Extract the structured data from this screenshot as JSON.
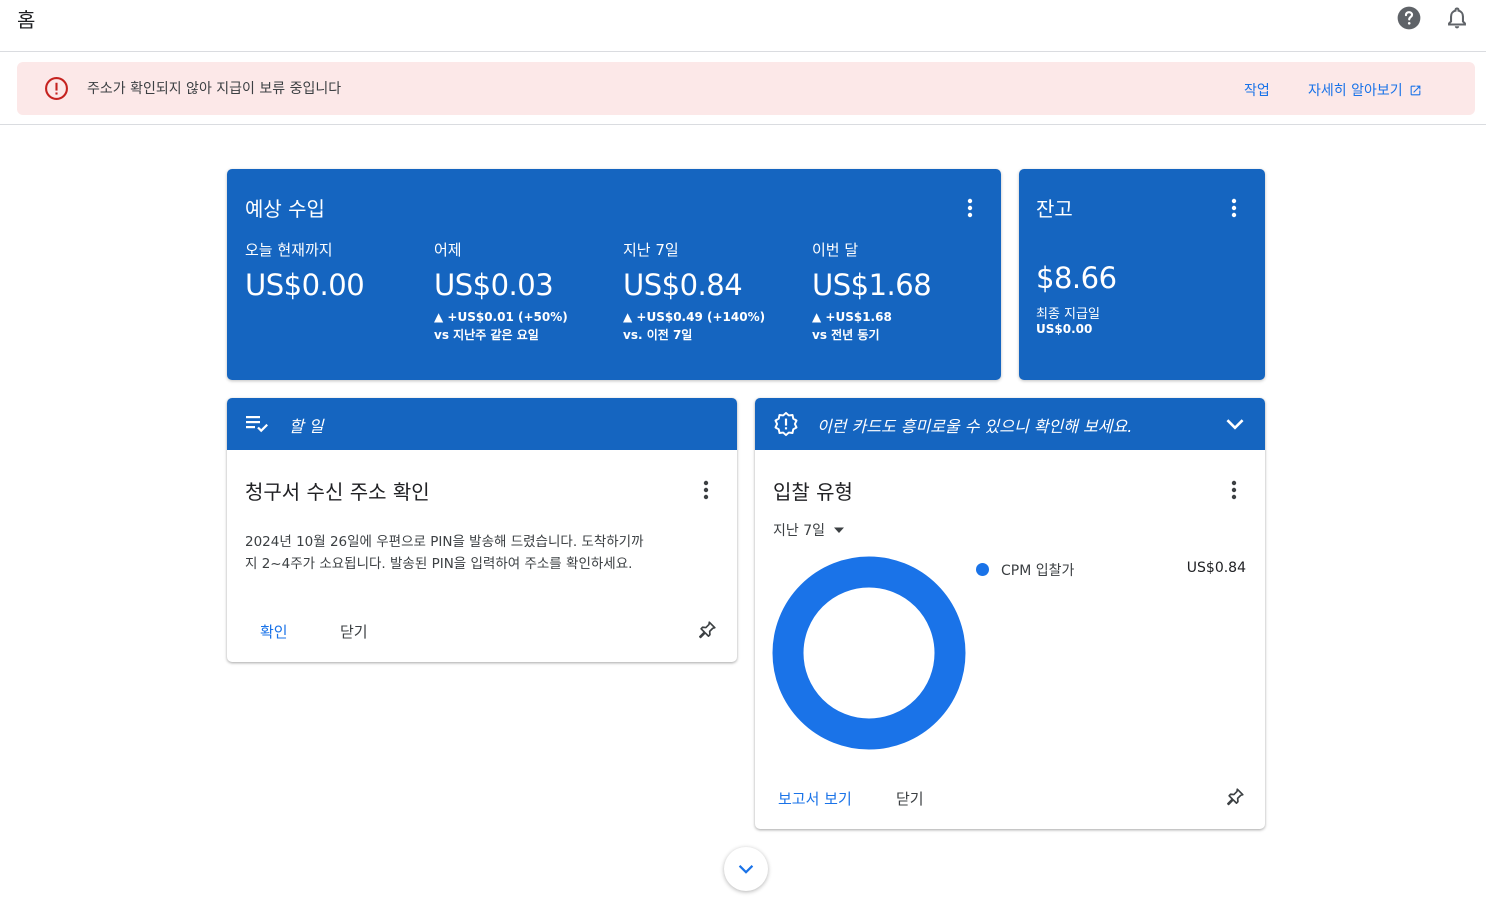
{
  "header": {
    "title": "홈"
  },
  "alert": {
    "message": "주소가 확인되지 않아 지급이 보류 중입니다",
    "action_label": "작업",
    "learn_more_label": "자세히 알아보기"
  },
  "earnings_card": {
    "title": "예상 수입",
    "metrics": [
      {
        "label": "오늘 현재까지",
        "value": "US$0.00",
        "delta": "",
        "compare": ""
      },
      {
        "label": "어제",
        "value": "US$0.03",
        "delta": "▲ +US$0.01 (+50%)",
        "compare": "vs 지난주 같은 요일"
      },
      {
        "label": "지난 7일",
        "value": "US$0.84",
        "delta": "▲ +US$0.49 (+140%)",
        "compare": "vs. 이전 7일"
      },
      {
        "label": "이번 달",
        "value": "US$1.68",
        "delta": "▲ +US$1.68",
        "compare": "vs 전년 동기"
      }
    ]
  },
  "balance_card": {
    "title": "잔고",
    "value": "$8.66",
    "last_payment_label": "최종 지급일",
    "last_payment_value": "US$0.00"
  },
  "todo_card": {
    "header": "할 일",
    "title": "청구서 수신 주소 확인",
    "body_line1": "2024년 10월 26일에 우편으로 PIN을 발송해 드렸습니다. 도착하기까",
    "body_line2": "지 2~4주가 소요됩니다. 발송된 PIN을 입력하여 주소를 확인하세요.",
    "confirm_label": "확인",
    "close_label": "닫기"
  },
  "bid_card": {
    "header": "이런 카드도 흥미로울 수 있으니 확인해 보세요.",
    "title": "입찰 유형",
    "period": "지난 7일",
    "legend": [
      {
        "name": "CPM 입찰가",
        "value": "US$0.84",
        "color": "#1a73e8"
      }
    ],
    "report_label": "보고서 보기",
    "close_label": "닫기"
  },
  "chart_data": {
    "type": "pie",
    "title": "",
    "categories": [
      "CPM 입찰가"
    ],
    "values": [
      0.84
    ],
    "colors": [
      "#1a73e8"
    ]
  },
  "colors": {
    "primary_blue": "#1565c0",
    "link_blue": "#1a73e8",
    "alert_bg": "#fce8e8",
    "alert_icon": "#c5221f"
  }
}
